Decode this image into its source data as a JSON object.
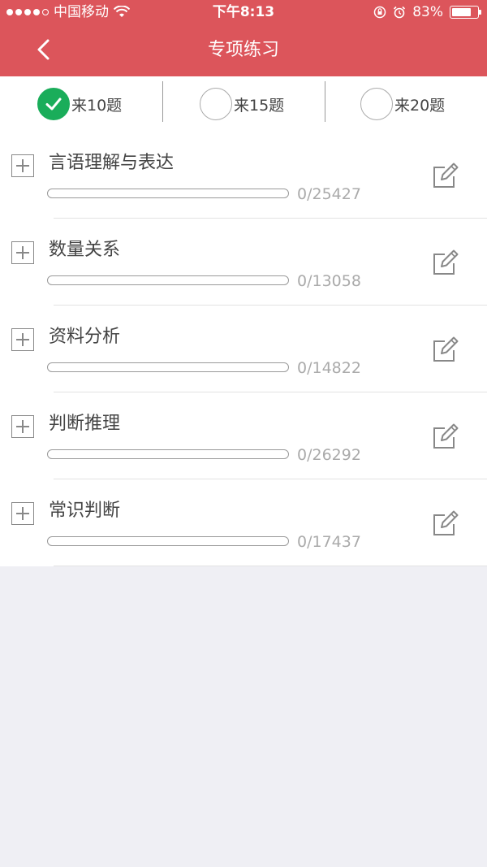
{
  "status_bar": {
    "carrier": "中国移动",
    "time": "下午8:13",
    "battery": "83%",
    "battery_level": 0.83
  },
  "nav": {
    "title": "专项练习"
  },
  "count_options": [
    {
      "label": "来10题",
      "selected": true
    },
    {
      "label": "来15题",
      "selected": false
    },
    {
      "label": "来20题",
      "selected": false
    }
  ],
  "categories": [
    {
      "name": "言语理解与表达",
      "done": 0,
      "total": 25427,
      "count_text": "0/25427",
      "progress": 0
    },
    {
      "name": "数量关系",
      "done": 0,
      "total": 13058,
      "count_text": "0/13058",
      "progress": 0
    },
    {
      "name": "资料分析",
      "done": 0,
      "total": 14822,
      "count_text": "0/14822",
      "progress": 0
    },
    {
      "name": "判断推理",
      "done": 0,
      "total": 26292,
      "count_text": "0/26292",
      "progress": 0
    },
    {
      "name": "常识判断",
      "done": 0,
      "total": 17437,
      "count_text": "0/17437",
      "progress": 0
    }
  ],
  "colors": {
    "accent": "#dc555b",
    "check_green": "#1aad5a"
  },
  "icons": {
    "back": "chevron-left-icon",
    "expand": "plus-square-icon",
    "edit": "pencil-edit-icon",
    "check": "checkmark-icon"
  }
}
